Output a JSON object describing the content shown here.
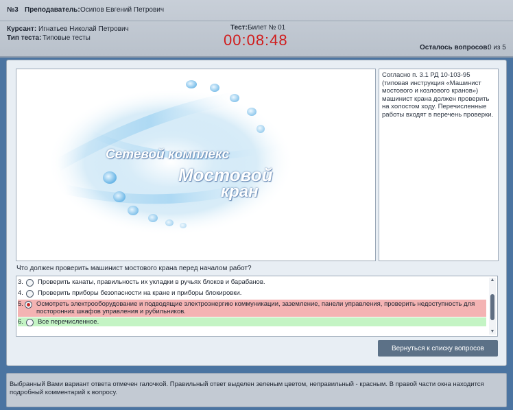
{
  "header": {
    "number": "№3",
    "teacher_label": "Преподаватель:",
    "teacher_name": "Осипов Евгений Петрович",
    "student_label": "Курсант:",
    "student_name": "Игнатьев Николай Петрович",
    "test_type_label": "Тип теста:",
    "test_type": "Типовые тесты",
    "test_label": "Тест:",
    "test_name": "Билет № 01",
    "timer": "00:08:48",
    "remaining_label": "Осталось вопросов:",
    "remaining_value": "0 из 5"
  },
  "image_logo": {
    "line1": "Сетевой комплекс",
    "line2": "Мостовой",
    "line3": "кран"
  },
  "comment": "Согласно п. 3.1 РД 10-103-95 (типовая инструкция «Машинист мостового и козлового кранов») машинист крана должен проверить на холостом ходу. Перечисленные работы входят в перечень проверки.",
  "question": "Что должен проверить машинист мостового крана перед началом работ?",
  "answers": [
    {
      "num": "3.",
      "text": "Проверить канаты, правильность их укладки в ручьях блоков и барабанов.",
      "state": "none",
      "selected": false
    },
    {
      "num": "4.",
      "text": "Проверить приборы безопасности на кране и приборы блокировки.",
      "state": "none",
      "selected": false
    },
    {
      "num": "5.",
      "text": "Осмотреть электрооборудование и подводящие электроэнергию коммуникации, заземление, панели управления, проверить недоступность для посторонних шкафов управления и рубильников.",
      "state": "wrong",
      "selected": true
    },
    {
      "num": "6.",
      "text": "Все перечисленное.",
      "state": "correct",
      "selected": false
    }
  ],
  "colors": {
    "wrong": "#f4b3b3",
    "correct": "#c4f4c4",
    "timer": "#d01c1c"
  },
  "back_button": "Вернуться к списку вопросов",
  "footer": "Выбранный Вами вариант ответа отмечен галочкой. Правильный ответ выделен зеленым цветом, неправильный - красным. В правой части окна находится подробный комментарий к вопросу."
}
